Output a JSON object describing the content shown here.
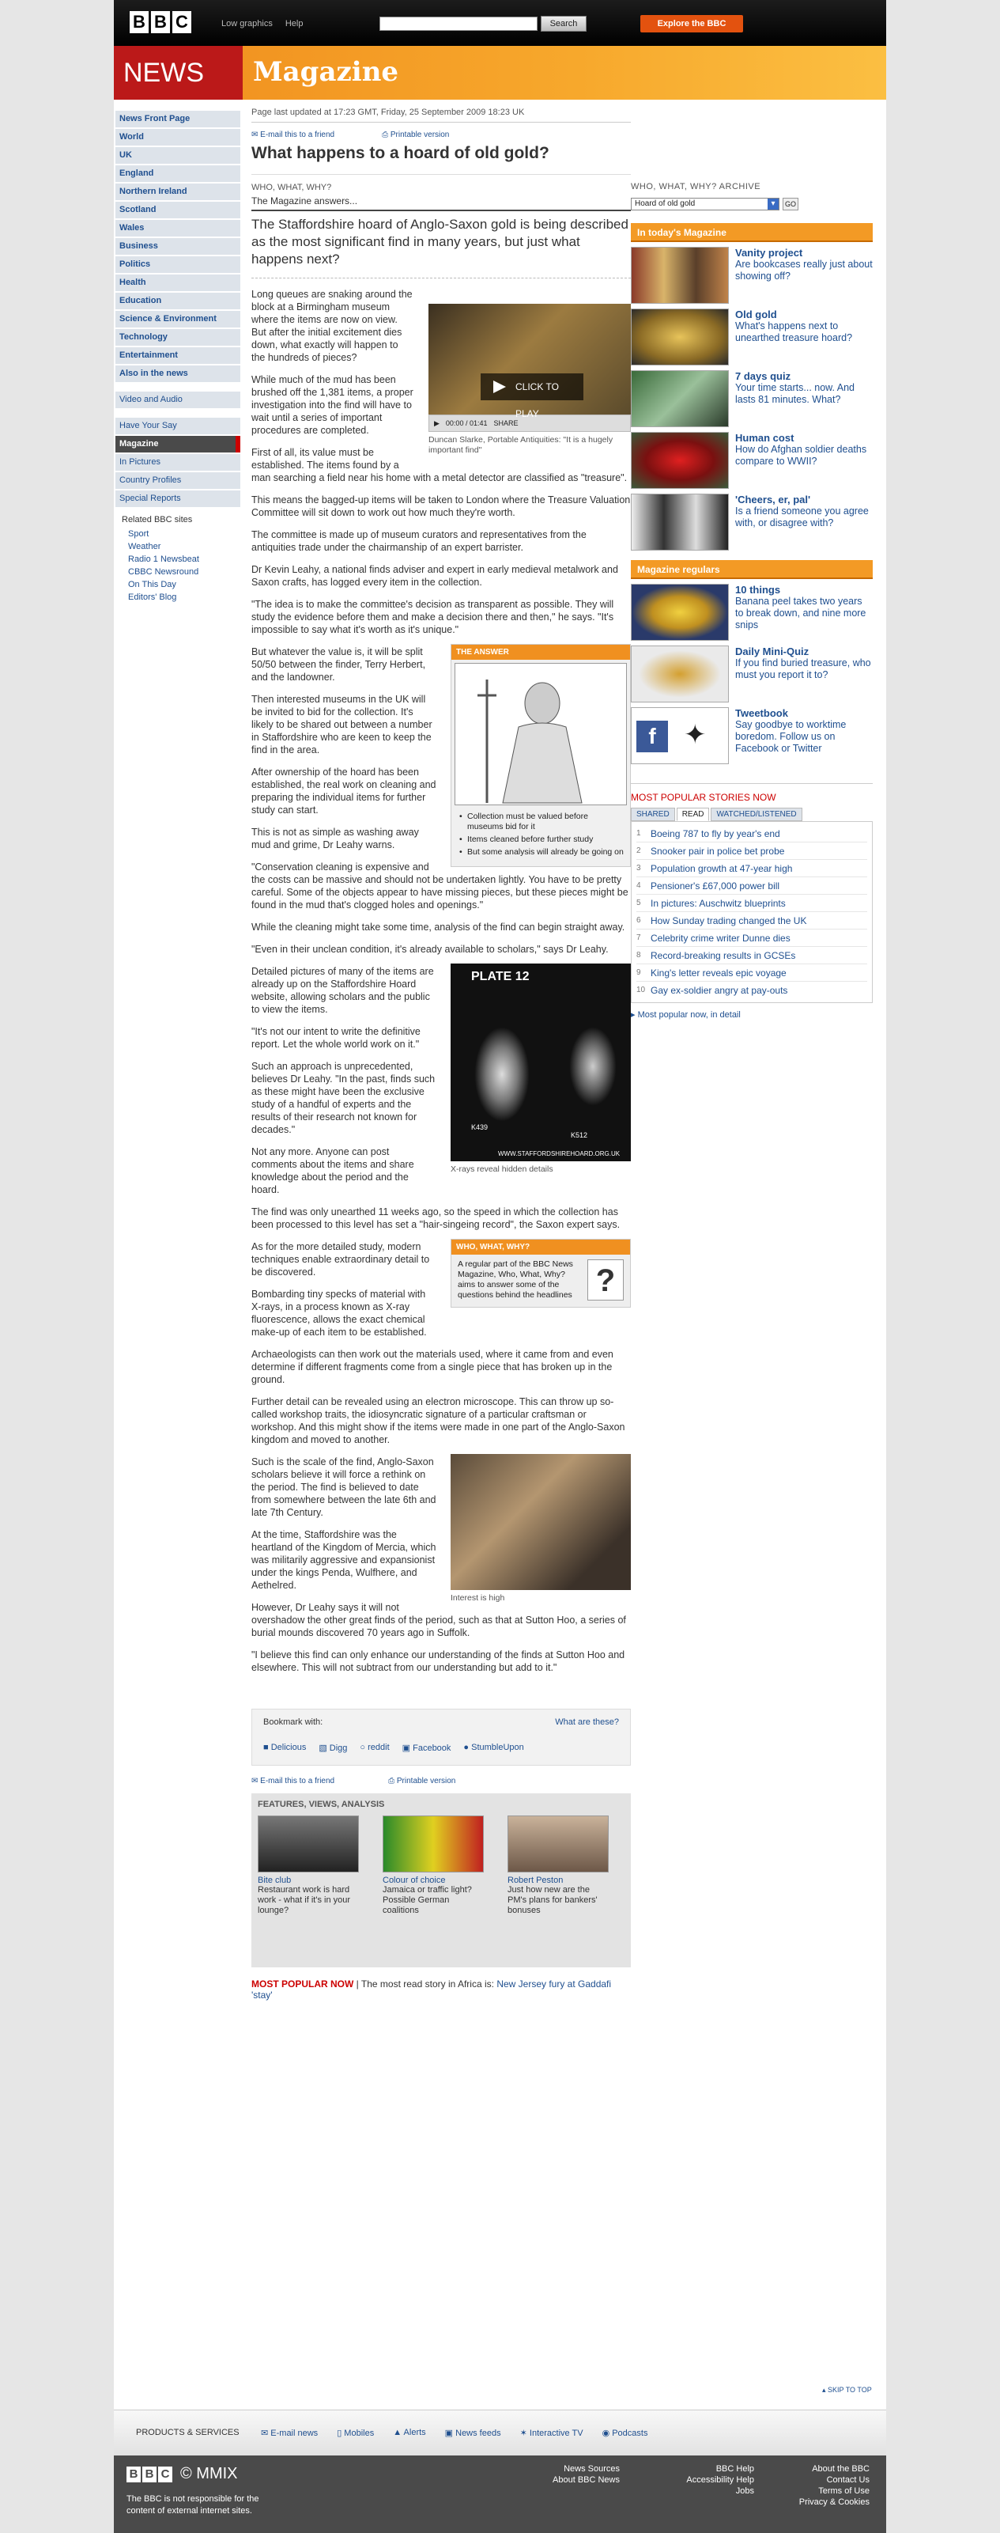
{
  "masthead": {
    "logo_letters": [
      "B",
      "B",
      "C"
    ],
    "low_graphics": "Low graphics",
    "help": "Help",
    "search_button": "Search",
    "explore": "Explore the BBC"
  },
  "banner": {
    "news": "NEWS",
    "section": "Magazine"
  },
  "leftnav": {
    "items": [
      "News Front Page",
      "World",
      "UK",
      "England",
      "Northern Ireland",
      "Scotland",
      "Wales",
      "Business",
      "Politics",
      "Health",
      "Education",
      "Science & Environment",
      "Technology",
      "Entertainment",
      "Also in the news"
    ],
    "video_audio": "Video and Audio",
    "sub": [
      "Have Your Say",
      "Magazine",
      "In Pictures",
      "Country Profiles",
      "Special Reports"
    ],
    "related_heading": "Related BBC sites",
    "related": [
      "Sport",
      "Weather",
      "Radio 1 Newsbeat",
      "CBBC Newsround",
      "On This Day",
      "Editors' Blog"
    ]
  },
  "article": {
    "updated": "Page last updated at 17:23 GMT, Friday, 25 September 2009 18:23 UK",
    "email": "E-mail this to a friend",
    "print": "Printable version",
    "headline": "What happens to a hoard of old gold?",
    "kicker": "WHO, WHAT, WHY?",
    "kicker2": "The Magazine answers...",
    "intro": "The Staffordshire hoard of Anglo-Saxon gold is being described as the most significant find in many years, but just what happens next?",
    "video_play": "CLICK TO PLAY",
    "video_time": "00:00 / 01:41",
    "video_share": "SHARE",
    "video_caption": "Duncan Slarke, Portable Antiquities: \"It is a hugely important find\"",
    "p1": "Long queues are snaking around the block at a Birmingham museum where the items are now on view. But after the initial excitement dies down, what exactly will happen to the hundreds of pieces?",
    "p2": "While much of the mud has been brushed off the 1,381 items, a proper investigation into the find will have to wait until a series of important procedures are completed.",
    "p3": "First of all, its value must be established. The items found by a man searching a field near his home with a metal detector are classified as \"treasure\".",
    "p4": "This means the bagged-up items will be taken to London where the Treasure Valuation Committee will sit down to work out how much they're worth.",
    "p5": "The committee is made up of museum curators and representatives from the antiquities trade under the chairmanship of an expert barrister.",
    "p6": "Dr Kevin Leahy, a national finds adviser and expert in early medieval metalwork and Saxon crafts, has logged every item in the collection.",
    "p7": "\"The idea is to make the committee's decision as transparent as possible. They will study the evidence before them and make a decision there and then,\" he says. \"It's impossible to say what it's worth as it's unique.\"",
    "answer_title": "THE ANSWER",
    "answer_points": [
      "Collection must be valued before museums bid for it",
      "Items cleaned before further study",
      "But some analysis will already be going on"
    ],
    "p8": "But whatever the value is, it will be split 50/50 between the finder, Terry Herbert, and the landowner.",
    "p9": "Then interested museums in the UK will be invited to bid for the collection. It's likely to be shared out between a number in Staffordshire who are keen to keep the find in the area.",
    "p10": "After ownership of the hoard has been established, the real work on cleaning and preparing the individual items for further study can start.",
    "p11": "This is not as simple as washing away mud and grime, Dr Leahy warns.",
    "p12": "\"Conservation cleaning is expensive and the costs can be massive and should not be undertaken lightly. You have to be pretty careful. Some of the objects appear to have missing pieces, but these pieces might be found in the mud that's clogged holes and openings.\"",
    "p13": "While the cleaning might take some time, analysis of the find can begin straight away.",
    "p14": "\"Even in their unclean condition, it's already available to scholars,\" says Dr Leahy.",
    "xray_plate": "PLATE 12",
    "xray_k1": "K439",
    "xray_k2": "K512",
    "xray_url": "WWW.STAFFORDSHIREHOARD.ORG.UK",
    "xray_caption": "X-rays reveal hidden details",
    "p15": "Detailed pictures of many of the items are already up on the Staffordshire Hoard website, allowing scholars and the public to view the items.",
    "p16": "\"It's not our intent to write the definitive report. Let the whole world work on it.\"",
    "p17": "Such an approach is unprecedented, believes Dr Leahy. \"In the past, finds such as these might have been the exclusive study of a handful of experts and the results of their research not known for decades.\"",
    "p18": "Not any more. Anyone can post comments about the items and share knowledge about the period and the hoard.",
    "p19": "The find was only unearthed 11 weeks ago, so the speed in which the collection has been processed to this level has set a \"hair-singeing record\", the Saxon expert says.",
    "www_title": "WHO, WHAT, WHY?",
    "www_text": "A regular part of the BBC News Magazine, Who, What, Why? aims to answer some of the questions behind the headlines",
    "p20": "As for the more detailed study, modern techniques enable extraordinary detail to be discovered.",
    "p21": "Bombarding tiny specks of material with X-rays, in a process known as X-ray fluorescence, allows the exact chemical make-up of each item to be established.",
    "p22": "Archaeologists can then work out the materials used, where it came from and even determine if different fragments come from a single piece that has broken up in the ground.",
    "p23": "Further detail can be revealed using an electron microscope. This can throw up so-called workshop traits, the idiosyncratic signature of a particular craftsman or workshop. And this might show if the items were made in one part of the Anglo-Saxon kingdom and moved to another.",
    "p24": "Such is the scale of the find, Anglo-Saxon scholars believe it will force a rethink on the period. The find is believed to date from somewhere between the late 6th and late 7th Century.",
    "crowd_caption": "Interest is high",
    "p25": "At the time, Staffordshire was the heartland of the Kingdom of Mercia, which was militarily aggressive and expansionist under the kings Penda, Wulfhere, and Aethelred.",
    "p26": "However, Dr Leahy says it will not overshadow the other great finds of the period, such as that at Sutton Hoo, a series of burial mounds discovered 70 years ago in Suffolk.",
    "p27": "\"I believe this find can only enhance our understanding of the finds at Sutton Hoo and elsewhere. This will not subtract from our understanding but add to it.\""
  },
  "bookmark": {
    "label": "Bookmark with:",
    "what": "What are these?",
    "sites": [
      "Delicious",
      "Digg",
      "reddit",
      "Facebook",
      "StumbleUpon"
    ]
  },
  "fva": {
    "heading": "FEATURES, VIEWS, ANALYSIS",
    "cards": [
      {
        "title": "Bite club",
        "desc": "Restaurant work is hard work - what if it's in your lounge?"
      },
      {
        "title": "Colour of choice",
        "desc": "Jamaica or traffic light? Possible German coalitions"
      },
      {
        "title": "Robert Peston",
        "desc": "Just how new are the PM's plans for bankers' bonuses"
      }
    ]
  },
  "most_popular_now": {
    "label": "MOST POPULAR NOW",
    "text": "The most read story in Africa is:",
    "link": "New Jersey fury at Gaddafi 'stay'"
  },
  "right": {
    "archive": "WHO, WHAT, WHY? ARCHIVE",
    "select_value": "Hoard of old gold",
    "go": "GO",
    "today_bar": "In today's Magazine",
    "today": [
      {
        "title": "Vanity project",
        "desc": "Are bookcases really just about showing off?"
      },
      {
        "title": "Old gold",
        "desc": "What's happens next to unearthed treasure hoard?"
      },
      {
        "title": "7 days quiz",
        "desc": "Your time starts... now. And lasts 81 minutes. What?"
      },
      {
        "title": "Human cost",
        "desc": "How do Afghan soldier deaths compare to WWII?"
      },
      {
        "title": "'Cheers, er, pal'",
        "desc": "Is a friend someone you agree with, or disagree with?"
      }
    ],
    "regulars_bar": "Magazine regulars",
    "regulars": [
      {
        "title": "10 things",
        "desc": "Banana peel takes two years to break down, and nine more snips"
      },
      {
        "title": "Daily Mini-Quiz",
        "desc": "If you find buried treasure, who must you report it to?"
      },
      {
        "title": "Tweetbook",
        "desc": "Say goodbye to worktime boredom. Follow us on Facebook or Twitter"
      }
    ],
    "popular_heading": "MOST POPULAR STORIES NOW",
    "tabs": [
      "SHARED",
      "READ",
      "WATCHED/LISTENED"
    ],
    "popular": [
      "Boeing 787 to fly by year's end",
      "Snooker pair in police bet probe",
      "Population growth at 47-year high",
      "Pensioner's £67,000 power bill",
      "In pictures: Auschwitz blueprints",
      "How Sunday trading changed the UK",
      "Celebrity crime writer Dunne dies",
      "Record-breaking results in GCSEs",
      "King's letter reveals epic voyage",
      "Gay ex-soldier angry at pay-outs"
    ],
    "popular_more": "Most popular now, in detail"
  },
  "footer": {
    "skip": "SKIP TO TOP",
    "products_label": "PRODUCTS & SERVICES",
    "products": [
      "E-mail news",
      "Mobiles",
      "Alerts",
      "News feeds",
      "Interactive TV",
      "Podcasts"
    ],
    "mmix": "© MMIX",
    "disclaimer": "The BBC is not responsible for the content of external internet sites.",
    "col1": [
      "News Sources",
      "About BBC News"
    ],
    "col2": [
      "BBC Help",
      "Accessibility Help",
      "Jobs"
    ],
    "col3": [
      "About the BBC",
      "Contact Us",
      "Terms of Use",
      "Privacy & Cookies"
    ]
  }
}
